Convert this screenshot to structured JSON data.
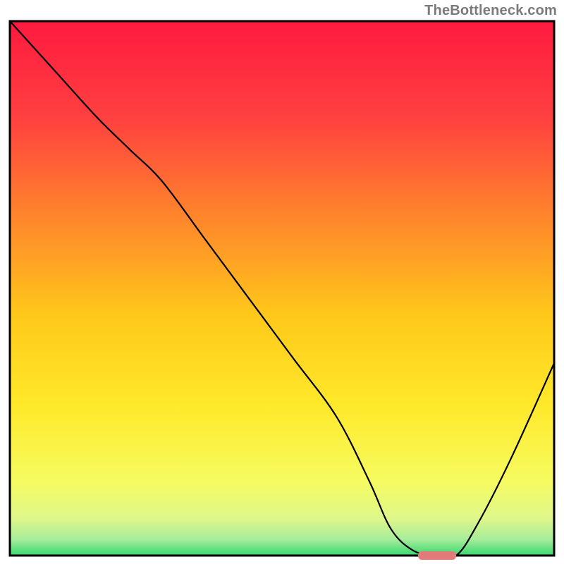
{
  "watermark": "TheBottleneck.com",
  "chart_data": {
    "type": "line",
    "title": "",
    "xlabel": "",
    "ylabel": "",
    "xlim": [
      0,
      100
    ],
    "ylim": [
      0,
      100
    ],
    "grid": false,
    "legend": false,
    "background_gradient": {
      "description": "Vertical rainbow gradient inside the plot frame, top-to-bottom, suggesting 'bad' (red) at top and 'good' (green) at bottom.",
      "stops": [
        {
          "offset": 0.0,
          "color": "#ff1a3f"
        },
        {
          "offset": 0.18,
          "color": "#ff4040"
        },
        {
          "offset": 0.38,
          "color": "#ff8a2a"
        },
        {
          "offset": 0.55,
          "color": "#ffc81a"
        },
        {
          "offset": 0.72,
          "color": "#ffe92a"
        },
        {
          "offset": 0.86,
          "color": "#f6fb60"
        },
        {
          "offset": 0.93,
          "color": "#dff78a"
        },
        {
          "offset": 0.97,
          "color": "#a6ed9a"
        },
        {
          "offset": 1.0,
          "color": "#38d86e"
        }
      ]
    },
    "series": [
      {
        "name": "curve",
        "stroke": "#000000",
        "stroke_width": 2.2,
        "x": [
          0,
          8,
          16,
          22,
          28,
          36,
          44,
          52,
          60,
          66,
          70,
          74,
          78,
          82,
          86,
          92,
          100
        ],
        "y": [
          100,
          91,
          82,
          76,
          70,
          59,
          48,
          37,
          26,
          14,
          5,
          1,
          0,
          0,
          6,
          18,
          36
        ]
      }
    ],
    "optimum_marker": {
      "description": "Small rounded pink bar on the x-axis marking the minimum (optimal) region.",
      "x_start": 75,
      "x_end": 82,
      "y": 0,
      "color": "#e37a7a"
    }
  }
}
